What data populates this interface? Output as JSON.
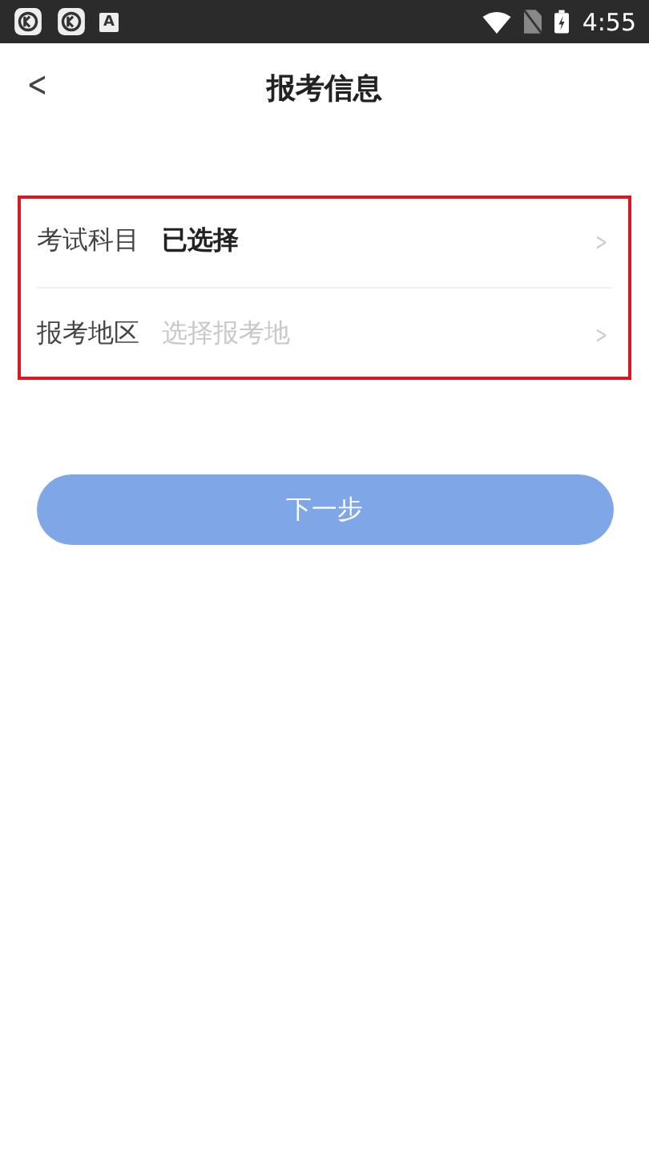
{
  "status_bar": {
    "notification_letter": "A",
    "time": "4:55"
  },
  "nav": {
    "back": "<",
    "title": "报考信息"
  },
  "fields": [
    {
      "label": "考试科目",
      "value": "已选择",
      "chevron": ">"
    },
    {
      "label": "报考地区",
      "placeholder": "选择报考地",
      "chevron": ">"
    }
  ],
  "next_button": {
    "label": "下一步",
    "disabled": true
  }
}
